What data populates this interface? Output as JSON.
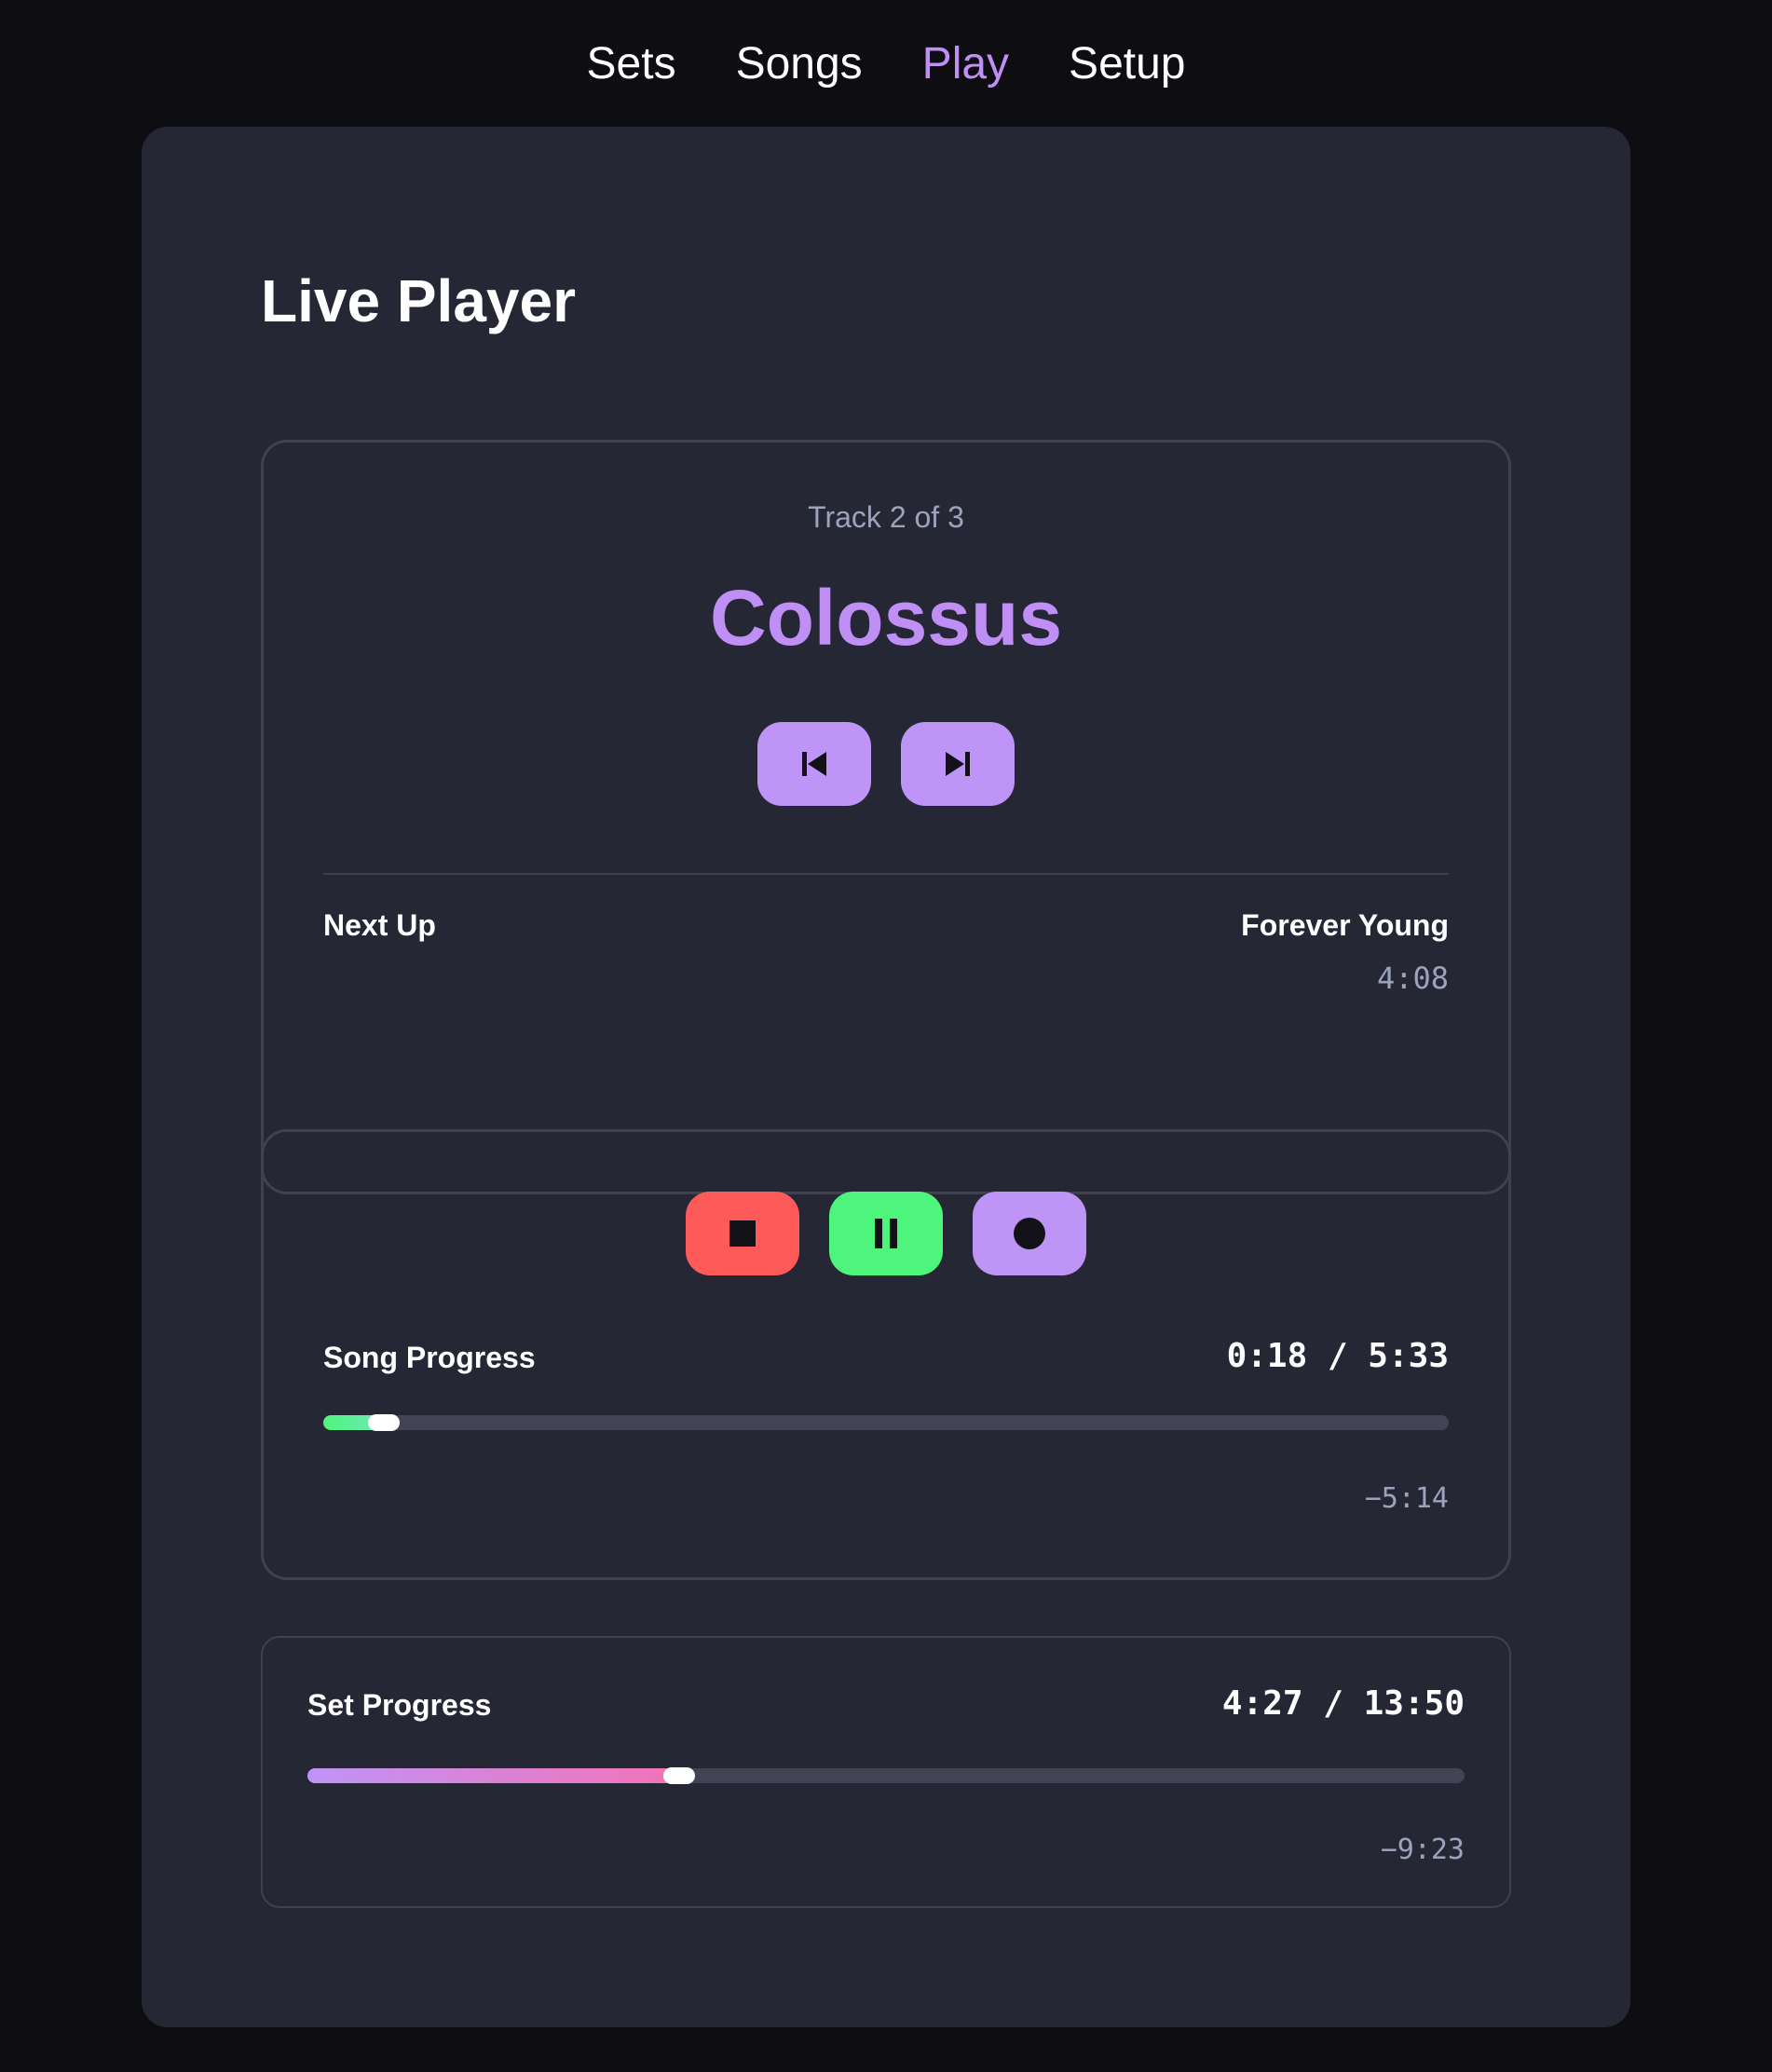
{
  "nav": {
    "items": [
      {
        "label": "Sets",
        "active": false
      },
      {
        "label": "Songs",
        "active": false
      },
      {
        "label": "Play",
        "active": true
      },
      {
        "label": "Setup",
        "active": false
      }
    ]
  },
  "page": {
    "title": "Live Player"
  },
  "track": {
    "count_label": "Track 2 of 3",
    "title": "Colossus",
    "controls": {
      "prev_icon": "skip-previous-icon",
      "next_icon": "skip-next-icon"
    },
    "next_up": {
      "label": "Next Up",
      "song": "Forever Young",
      "duration": "4:08"
    }
  },
  "transport": {
    "buttons": [
      {
        "name": "stop",
        "icon": "stop-icon",
        "color": "#ff5a5a"
      },
      {
        "name": "pause",
        "icon": "pause-icon",
        "color": "#4ef57c"
      },
      {
        "name": "record",
        "icon": "record-icon",
        "color": "#bf94f7"
      }
    ],
    "song_progress": {
      "label": "Song Progress",
      "time": "0:18 / 5:33",
      "remaining": "−5:14",
      "fraction": 0.054
    }
  },
  "set_progress": {
    "label": "Set Progress",
    "time": "4:27 / 13:50",
    "remaining": "−9:23",
    "fraction": 0.321
  },
  "colors": {
    "accent": "#bf8ff5",
    "background": "#0e0d12",
    "panel": "#262735",
    "muted_text": "#9ba3bd",
    "stop": "#ff5a5a",
    "play": "#4ef57c"
  }
}
